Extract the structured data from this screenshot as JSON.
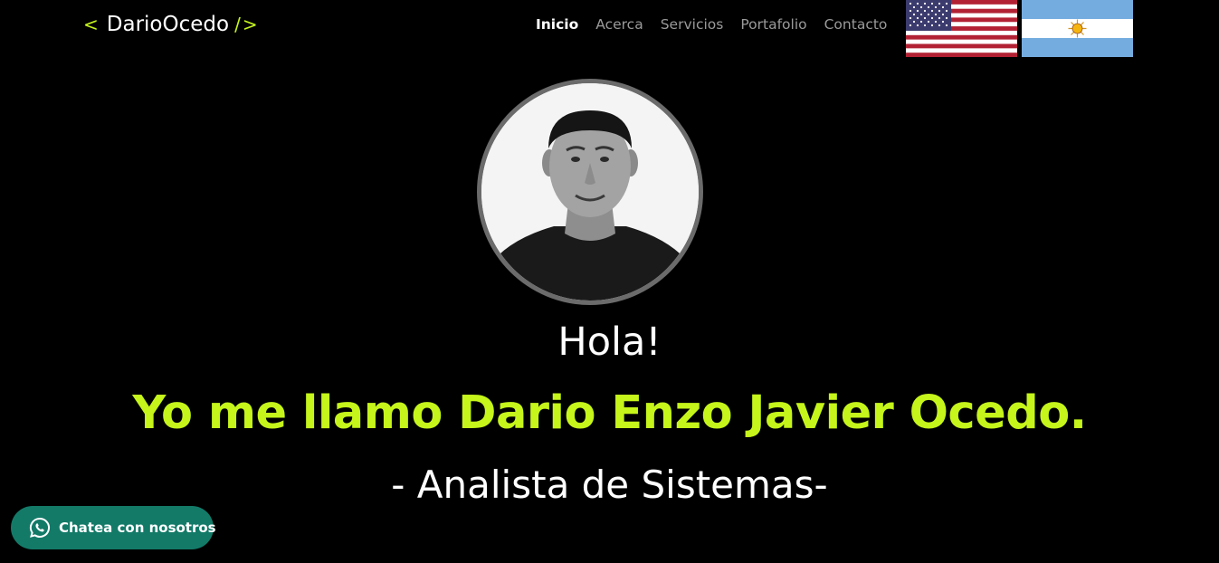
{
  "header": {
    "logo": {
      "open_bracket": "<",
      "name": "DarioOcedo",
      "close_slash": "/",
      "close_bracket": ">"
    },
    "nav": {
      "items": [
        {
          "label": "Inicio",
          "active": true
        },
        {
          "label": "Acerca",
          "active": false
        },
        {
          "label": "Servicios",
          "active": false
        },
        {
          "label": "Portafolio",
          "active": false
        },
        {
          "label": "Contacto",
          "active": false
        }
      ]
    },
    "languages": [
      {
        "icon": "us-flag-icon",
        "language": "English"
      },
      {
        "icon": "argentina-flag-icon",
        "language": "Español"
      }
    ]
  },
  "hero": {
    "avatar_icon": "profile-photo",
    "greeting": "Hola!",
    "headline": "Yo me llamo Dario Enzo Javier Ocedo.",
    "subtitle": "- Analista de Sistemas-"
  },
  "chat_widget": {
    "icon": "whatsapp-icon",
    "label": "Chatea con nosotros"
  },
  "colors": {
    "background": "#000000",
    "accent": "#c5f51a",
    "nav_inactive": "#9a9a9a",
    "chat_button": "#137a68",
    "avatar_ring": "#6b6b6b"
  }
}
